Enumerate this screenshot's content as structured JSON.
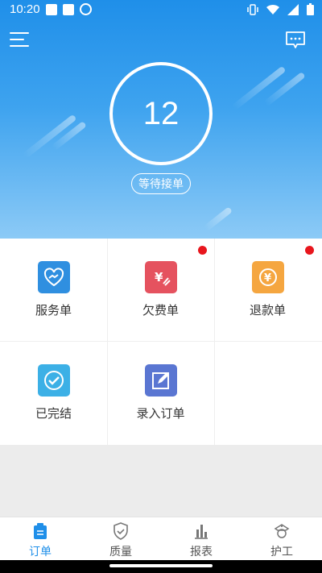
{
  "status_bar": {
    "time": "10:20"
  },
  "hero": {
    "pending_count": "12",
    "status_label": "等待接单"
  },
  "grid": {
    "items": [
      {
        "label": "服务单",
        "icon": "handshake-heart-icon",
        "color": "#2f8fe0",
        "badge": false
      },
      {
        "label": "欠费单",
        "icon": "yen-hand-icon",
        "color": "#e5525f",
        "badge": true
      },
      {
        "label": "退款单",
        "icon": "yen-refund-icon",
        "color": "#f5a640",
        "badge": true
      },
      {
        "label": "已完结",
        "icon": "check-circle-icon",
        "color": "#3cb0e6",
        "badge": false
      },
      {
        "label": "录入订单",
        "icon": "edit-icon",
        "color": "#5a76d2",
        "badge": false
      }
    ]
  },
  "tabs": [
    {
      "label": "订单",
      "icon": "clipboard-icon",
      "active": true
    },
    {
      "label": "质量",
      "icon": "shield-check-icon",
      "active": false
    },
    {
      "label": "报表",
      "icon": "bar-chart-icon",
      "active": false
    },
    {
      "label": "护工",
      "icon": "nurse-icon",
      "active": false
    }
  ],
  "colors": {
    "primary": "#1f8fe9",
    "badge": "#e8161d"
  }
}
